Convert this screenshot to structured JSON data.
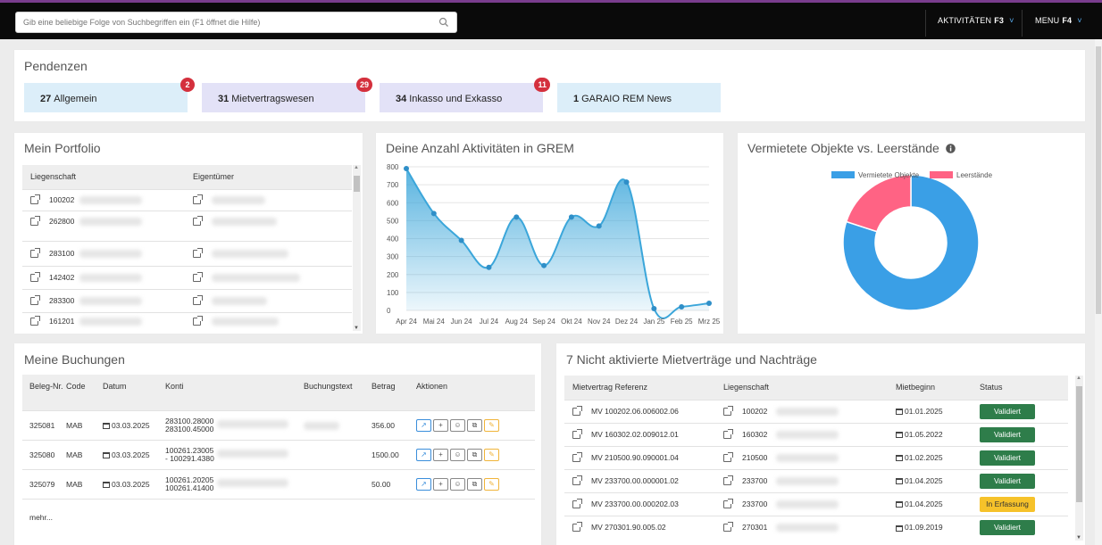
{
  "topbar": {
    "search_placeholder": "Gib eine beliebige Folge von Suchbegriffen ein (F1 öffnet die Hilfe)",
    "activities_label": "AKTIVITÄTEN",
    "activities_key": "F3",
    "menu_label": "MENU",
    "menu_key": "F4"
  },
  "pendenzen": {
    "title": "Pendenzen",
    "cards": [
      {
        "count": "27",
        "label": "Allgemein",
        "badge": "2",
        "color": "#dceef9"
      },
      {
        "count": "31",
        "label": "Mietvertragswesen",
        "badge": "29",
        "color": "#e3e2f7"
      },
      {
        "count": "34",
        "label": "Inkasso und Exkasso",
        "badge": "11",
        "color": "#e3e2f7"
      },
      {
        "count": "1",
        "label": "GARAIO REM News",
        "badge": "",
        "color": "#dceef9"
      }
    ]
  },
  "portfolio": {
    "title": "Mein Portfolio",
    "col_liegenschaft": "Liegenschaft",
    "col_eigentuemer": "Eigentümer",
    "rows": [
      "100202",
      "262800",
      "283100",
      "142402",
      "283300",
      "161201"
    ]
  },
  "activities_chart": {
    "title": "Deine Anzahl Aktivitäten in GREM"
  },
  "donut": {
    "title": "Vermietete Objekte vs. Leerstände",
    "legend_rented": "Vermietete Objekte",
    "legend_vacant": "Leerstände"
  },
  "chart_data": [
    {
      "type": "area",
      "title": "Deine Anzahl Aktivitäten in GREM",
      "categories": [
        "Apr 24",
        "Mai 24",
        "Jun 24",
        "Jul 24",
        "Aug 24",
        "Sep 24",
        "Okt 24",
        "Nov 24",
        "Dez 24",
        "Jan 25",
        "Feb 25",
        "Mrz 25"
      ],
      "values": [
        790,
        540,
        390,
        240,
        520,
        250,
        520,
        470,
        715,
        10,
        20,
        40
      ],
      "ylim": [
        0,
        800
      ],
      "yticks": [
        "800",
        "700",
        "600",
        "500",
        "400",
        "300",
        "200",
        "100",
        "0"
      ],
      "color": "#3ba6da",
      "grid": true
    },
    {
      "type": "pie",
      "donut": true,
      "labels": [
        "Vermietete Objekte",
        "Leerstände"
      ],
      "values": [
        80,
        20
      ],
      "colors": [
        "#3a9fe6",
        "#ff6384"
      ],
      "legend": "top"
    }
  ],
  "buchungen": {
    "title": "Meine Buchungen",
    "headers": {
      "nr": "Beleg-Nr.",
      "code": "Code",
      "datum": "Datum",
      "konti": "Konti",
      "text": "Buchungstext",
      "betrag": "Betrag",
      "aktionen": "Aktionen"
    },
    "rows": [
      {
        "nr": "325081",
        "code": "MAB",
        "datum": "03.03.2025",
        "konti1": "283100.28000",
        "konti2": "283100.45000",
        "betrag": "356.00"
      },
      {
        "nr": "325080",
        "code": "MAB",
        "datum": "03.03.2025",
        "konti1": "100261.23005",
        "konti2": "- 100291.4380",
        "betrag": "1500.00"
      },
      {
        "nr": "325079",
        "code": "MAB",
        "datum": "03.03.2025",
        "konti1": "100261.20205",
        "konti2": "100261.41400",
        "betrag": "50.00"
      }
    ],
    "more": "mehr..."
  },
  "mietvertraege": {
    "title": "7 Nicht aktivierte Mietverträge und Nachträge",
    "headers": {
      "ref": "Mietvertrag Referenz",
      "ls": "Liegenschaft",
      "beginn": "Mietbeginn",
      "status": "Status"
    },
    "rows": [
      {
        "ref": "MV 100202.06.006002.06",
        "ls": "100202",
        "beginn": "01.01.2025",
        "status": "Validiert",
        "wip": false
      },
      {
        "ref": "MV 160302.02.009012.01",
        "ls": "160302",
        "beginn": "01.05.2022",
        "status": "Validiert",
        "wip": false
      },
      {
        "ref": "MV 210500.90.090001.04",
        "ls": "210500",
        "beginn": "01.02.2025",
        "status": "Validiert",
        "wip": false
      },
      {
        "ref": "MV 233700.00.000001.02",
        "ls": "233700",
        "beginn": "01.04.2025",
        "status": "Validiert",
        "wip": false
      },
      {
        "ref": "MV 233700.00.000202.03",
        "ls": "233700",
        "beginn": "01.04.2025",
        "status": "In Erfassung",
        "wip": true
      },
      {
        "ref": "MV 270301.90.005.02",
        "ls": "270301",
        "beginn": "01.09.2019",
        "status": "Validiert",
        "wip": false
      }
    ]
  }
}
